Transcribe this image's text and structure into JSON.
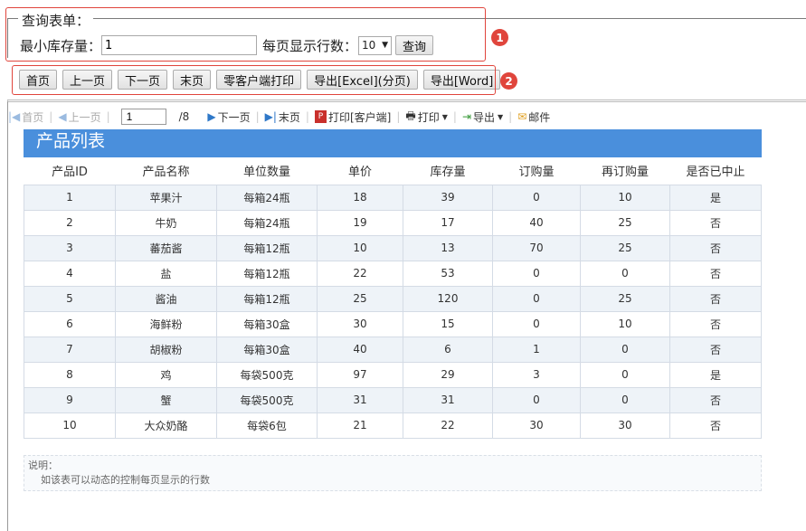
{
  "query_form": {
    "legend": "查询表单：",
    "min_stock_label": "最小库存量：",
    "min_stock_value": "1",
    "rows_per_page_label": "每页显示行数：",
    "rows_per_page_value": "10",
    "query_button": "查询"
  },
  "action_buttons": [
    "首页",
    "上一页",
    "下一页",
    "末页",
    "零客户端打印",
    "导出[Excel](分页)",
    "导出[Word]"
  ],
  "badges": [
    "1",
    "2"
  ],
  "toolbar": {
    "first": "首页",
    "prev": "上一页",
    "page_value": "1",
    "page_total": "/8",
    "next": "下一页",
    "last": "末页",
    "print_client": "打印[客户端]",
    "print": "打印",
    "export": "导出",
    "mail": "邮件"
  },
  "report": {
    "title": "产品列表",
    "columns": [
      "产品ID",
      "产品名称",
      "单位数量",
      "单价",
      "库存量",
      "订购量",
      "再订购量",
      "是否已中止"
    ],
    "rows": [
      [
        "1",
        "苹果汁",
        "每箱24瓶",
        "18",
        "39",
        "0",
        "10",
        "是"
      ],
      [
        "2",
        "牛奶",
        "每箱24瓶",
        "19",
        "17",
        "40",
        "25",
        "否"
      ],
      [
        "3",
        "蕃茄酱",
        "每箱12瓶",
        "10",
        "13",
        "70",
        "25",
        "否"
      ],
      [
        "4",
        "盐",
        "每箱12瓶",
        "22",
        "53",
        "0",
        "0",
        "否"
      ],
      [
        "5",
        "酱油",
        "每箱12瓶",
        "25",
        "120",
        "0",
        "25",
        "否"
      ],
      [
        "6",
        "海鲜粉",
        "每箱30盒",
        "30",
        "15",
        "0",
        "10",
        "否"
      ],
      [
        "7",
        "胡椒粉",
        "每箱30盒",
        "40",
        "6",
        "1",
        "0",
        "否"
      ],
      [
        "8",
        "鸡",
        "每袋500克",
        "97",
        "29",
        "3",
        "0",
        "是"
      ],
      [
        "9",
        "蟹",
        "每袋500克",
        "31",
        "31",
        "0",
        "0",
        "否"
      ],
      [
        "10",
        "大众奶酪",
        "每袋6包",
        "21",
        "22",
        "30",
        "30",
        "否"
      ]
    ],
    "note_title": "说明：",
    "note_text": "如该表可以动态的控制每页显示的行数"
  },
  "colors": {
    "accent": "#4a8fdc",
    "highlight": "#e0453c"
  }
}
